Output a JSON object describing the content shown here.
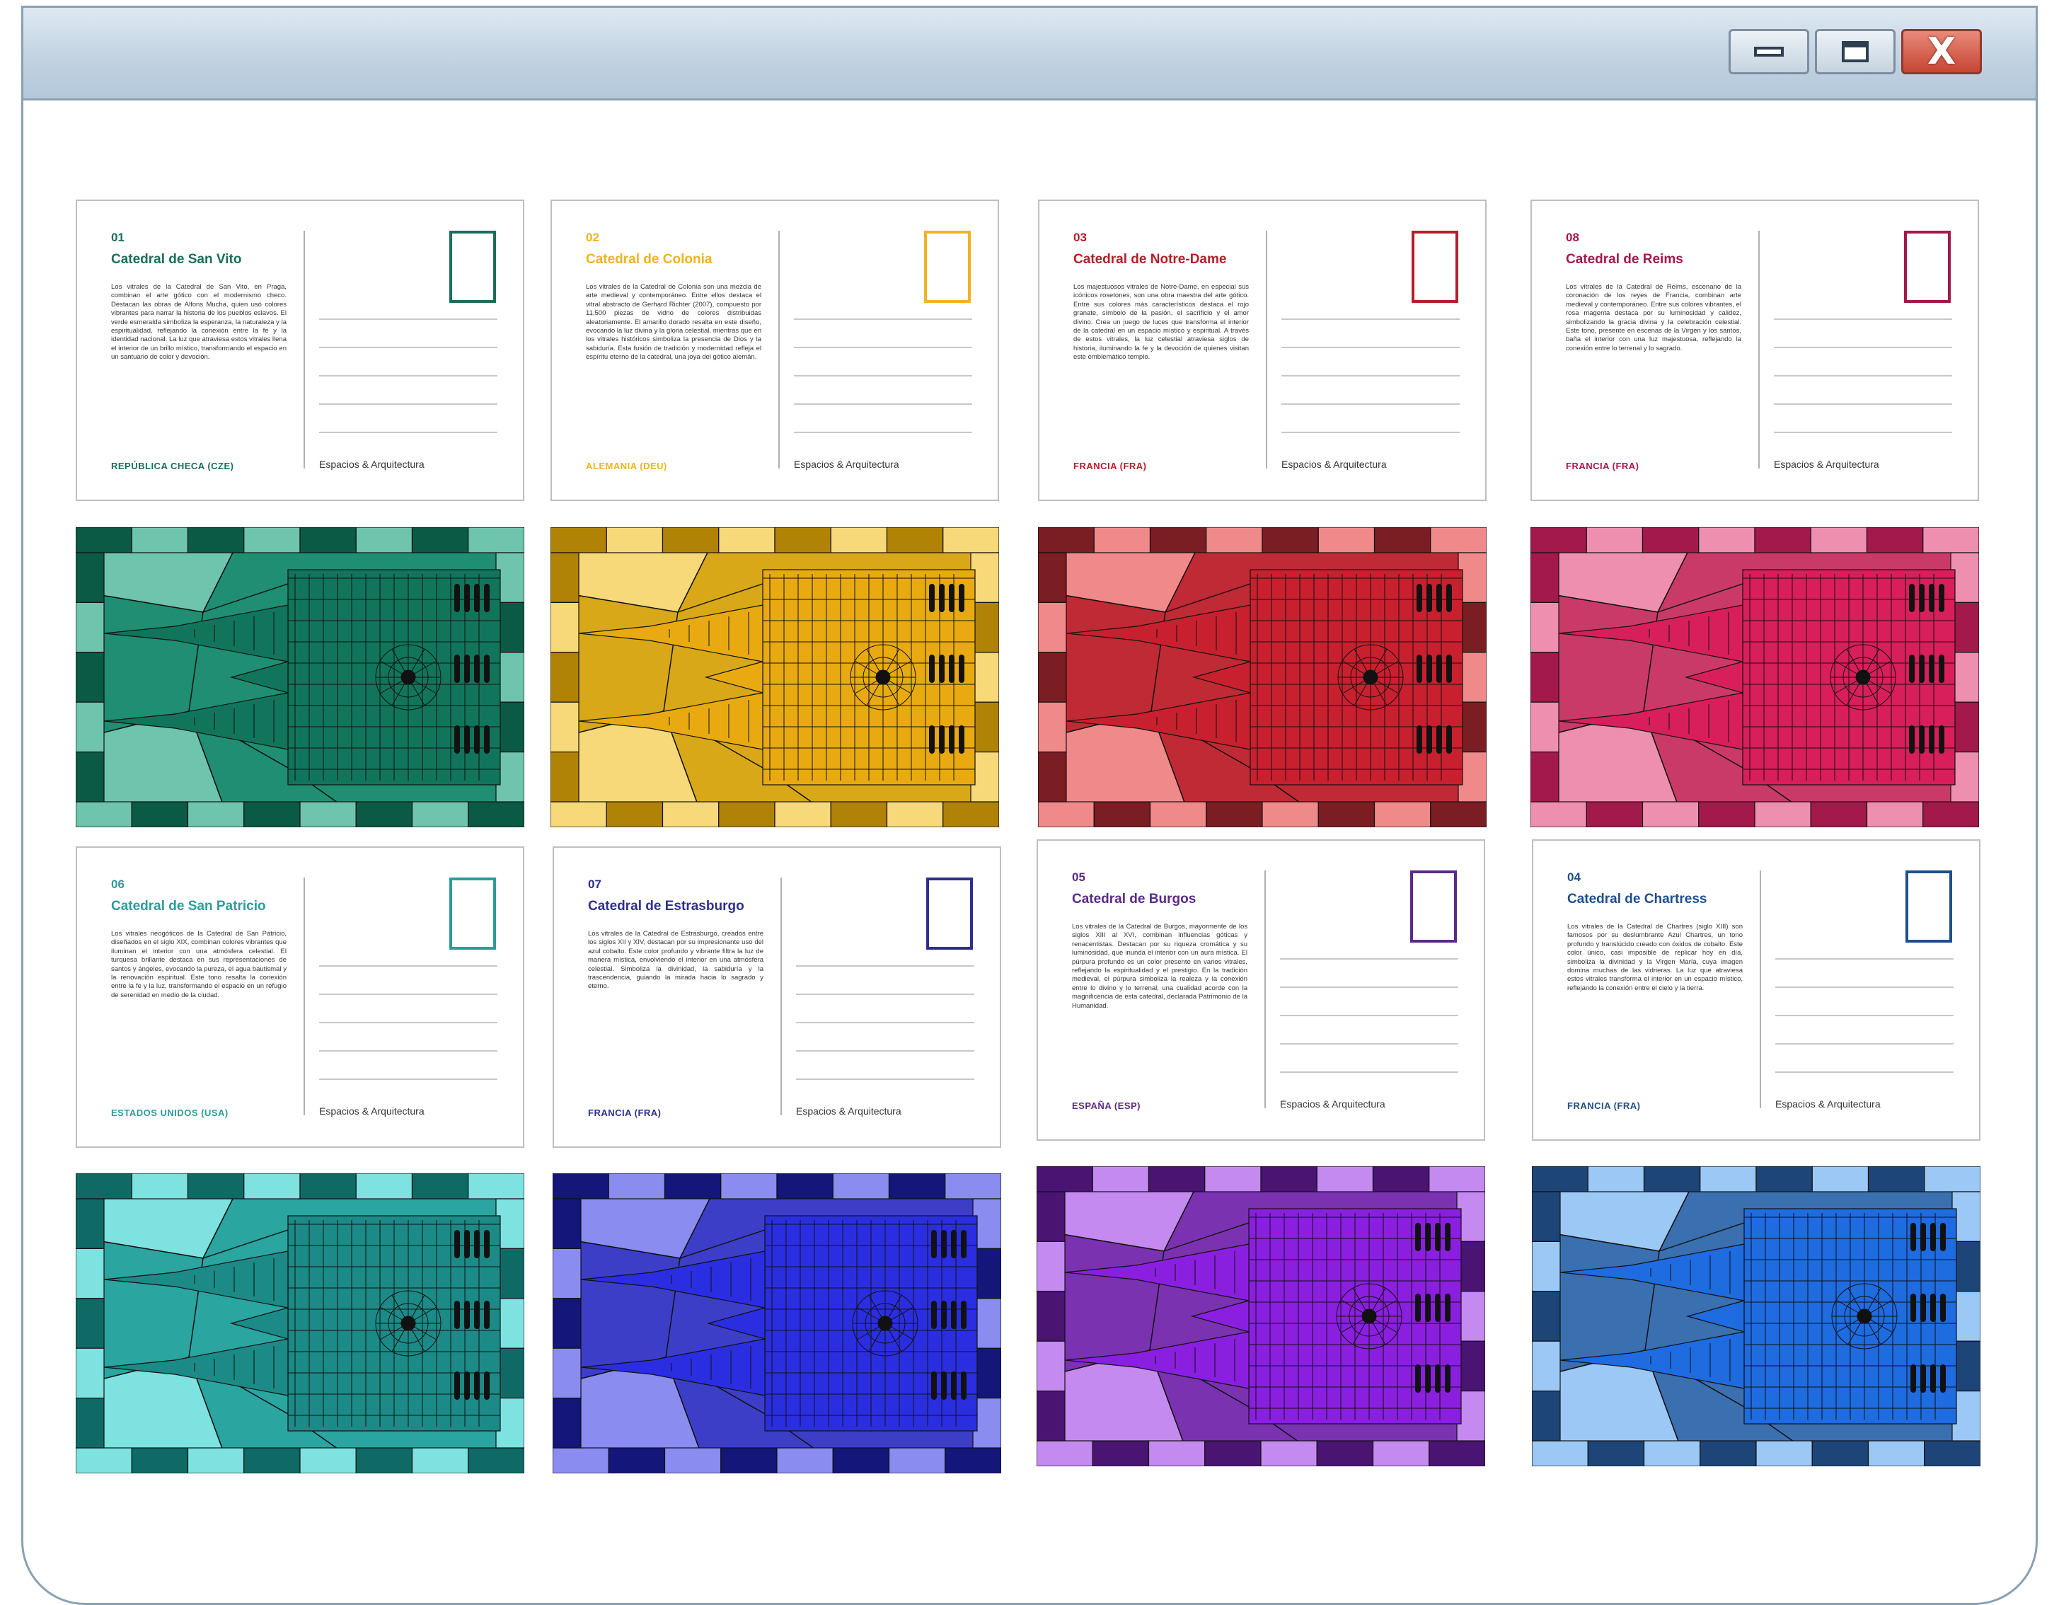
{
  "window": {
    "controls": {
      "minimize": "minimize",
      "maximize": "maximize",
      "close": "X"
    }
  },
  "brand": "Espacios & Arquitectura",
  "postcards": [
    {
      "num": "01",
      "title": "Catedral de San Vito",
      "country": "REPÚBLICA CHECA (CZE)",
      "color": "#1b6e5a",
      "body": "Los vitrales de la Catedral de San Vito, en Praga, combinan el arte gótico con el modernismo checo. Destacan las obras de Alfons Mucha, quien usó colores vibrantes para narrar la historia de los pueblos eslavos. El verde esmeralda simboliza la esperanza, la naturaleza y la espiritualidad, reflejando la conexión entre la fe y la identidad nacional. La luz que atraviesa estos vitrales llena el interior de un brillo místico, transformando el espacio en un santuario de color y devoción."
    },
    {
      "num": "02",
      "title": "Catedral de Colonia",
      "country": "ALEMANIA (DEU)",
      "color": "#f0b323",
      "body": "Los vitrales de la Catedral de Colonia son una mezcla de arte medieval y contemporáneo. Entre ellos destaca el vitral abstracto de Gerhard Richter (2007), compuesto por 11,500 piezas de vidrio de colores distribuidas aleatoriamente. El amarillo dorado resalta en este diseño, evocando la luz divina y la gloria celestial, mientras que en los vitrales históricos simboliza la presencia de Dios y la sabiduría. Esta fusión de tradición y modernidad refleja el espíritu eterno de la catedral, una joya del gótico alemán."
    },
    {
      "num": "03",
      "title": "Catedral de Notre-Dame",
      "country": "FRANCIA (FRA)",
      "color": "#b3202a",
      "body": "Los majestuosos vitrales de Notre-Dame, en especial sus icónicos rosetones, son una obra maestra del arte gótico. Entre sus colores más característicos destaca el rojo granate, símbolo de la pasión, el sacrificio y el amor divino. Crea un juego de luces que transforma el interior de la catedral en un espacio místico y espiritual. A través de estos vitrales, la luz celestial atraviesa siglos de historia, iluminando la fe y la devoción de quienes visitan este emblemático templo."
    },
    {
      "num": "08",
      "title": "Catedral de Reims",
      "country": "FRANCIA (FRA)",
      "color": "#a3194b",
      "body": "Los vitrales de la Catedral de Reims, escenario de la coronación de los reyes de Francia, combinan arte medieval y contemporáneo. Entre sus colores vibrantes, el rosa magenta destaca por su luminosidad y calidez, simbolizando la gracia divina y la celebración celestial. Este tono, presente en escenas de la Virgen y los santos, baña el interior con una luz majestuosa, reflejando la conexión entre lo terrenal y lo sagrado."
    },
    {
      "num": "06",
      "title": "Catedral de San Patricio",
      "country": "ESTADOS UNIDOS (USA)",
      "color": "#2a9d9b",
      "body": "Los vitrales neogóticos de la Catedral de San Patricio, diseñados en el siglo XIX, combinan colores vibrantes que iluminan el interior con una atmósfera celestial. El turquesa brillante destaca en sus representaciones de santos y ángeles, evocando la pureza, el agua bautismal y la renovación espiritual. Este tono resalta la conexión entre la fe y la luz, transformando el espacio en un refugio de serenidad en medio de la ciudad."
    },
    {
      "num": "07",
      "title": "Catedral de Estrasburgo",
      "country": "FRANCIA (FRA)",
      "color": "#2e2f8f",
      "body": "Los vitrales de la Catedral de Estrasburgo, creados entre los siglos XII y XIV, destacan por su impresionante uso del azul cobalto. Este color profundo y vibrante filtra la luz de manera mística, envolviendo el interior en una atmósfera celestial. Simboliza la divinidad, la sabiduría y la trascendencia, guiando la mirada hacia lo sagrado y eterno."
    },
    {
      "num": "05",
      "title": "Catedral de Burgos",
      "country": "ESPAÑA (ESP)",
      "color": "#5b2a86",
      "body": "Los vitrales de la Catedral de Burgos, mayormente de los siglos XIII al XVI, combinan influencias góticas y renacentistas. Destacan por su riqueza cromática y su luminosidad, que inunda el interior con un aura mística. El púrpura profundo es un color presente en varios vitrales, reflejando la espiritualidad y el prestigio. En la tradición medieval, el púrpura simboliza la realeza y la conexión entre lo divino y lo terrenal, una cualidad acorde con la magnificencia de esta catedral, declarada Patrimonio de la Humanidad."
    },
    {
      "num": "04",
      "title": "Catedral de Chartress",
      "country": "FRANCIA (FRA)",
      "color": "#1f4e8c",
      "body": "Los vitrales de la Catedral de Chartres (siglo XIII) son famosos por su deslumbrante Azul Chartres, un tono profundo y translúcido creado con óxidos de cobalto. Este color único, casi imposible de replicar hoy en día, simboliza la divinidad y la Virgen María, cuya imagen domina muchas de las vidrieras. La luz que atraviesa estos vitrales transforma el interior en un espacio místico, reflejando la conexión entre el cielo y la tierra."
    }
  ],
  "artworks": [
    {
      "name": "san-vito",
      "dark": "#0b5a45",
      "mid": "#1f8e72",
      "light": "#6fc4ad",
      "tower": "#11755b"
    },
    {
      "name": "colonia",
      "dark": "#b08205",
      "mid": "#d8a818",
      "light": "#f7d97a",
      "tower": "#e8aa10"
    },
    {
      "name": "notre-dame",
      "dark": "#7a1e24",
      "mid": "#c02a35",
      "light": "#f08a8a",
      "tower": "#c8202e"
    },
    {
      "name": "reims",
      "dark": "#a3194b",
      "mid": "#c93a68",
      "light": "#ef8fb0",
      "tower": "#d81e5b"
    },
    {
      "name": "san-patricio",
      "dark": "#0f6a66",
      "mid": "#2aa5a0",
      "light": "#7ee2e0",
      "tower": "#1c8a86"
    },
    {
      "name": "estrasburgo",
      "dark": "#14167a",
      "mid": "#3c3ec8",
      "light": "#8a8cf0",
      "tower": "#2a2ee0"
    },
    {
      "name": "burgos",
      "dark": "#4a1473",
      "mid": "#7a32b0",
      "light": "#c58af0",
      "tower": "#8a1fe0"
    },
    {
      "name": "chartres",
      "dark": "#1d4578",
      "mid": "#3a6fb0",
      "light": "#9cc8f5",
      "tower": "#1f6be0"
    }
  ]
}
